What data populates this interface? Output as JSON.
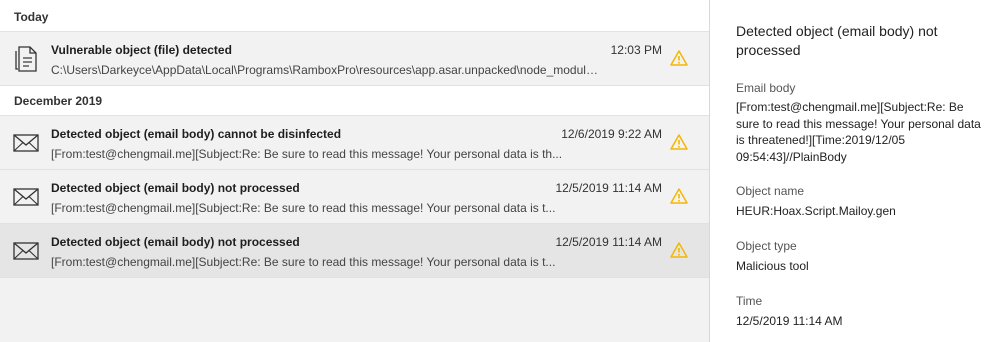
{
  "groups": [
    {
      "label": "Today"
    },
    {
      "label": "December 2019"
    }
  ],
  "items": [
    {
      "title": "Vulnerable object (file) detected",
      "preview": "C:\\Users\\Darkeyce\\AppData\\Local\\Programs\\RamboxPro\\resources\\app.asar.unpacked\\node_modules\\...",
      "time": "12:03 PM",
      "icon": "file-icon"
    },
    {
      "title": "Detected object (email body) cannot be disinfected",
      "preview": "[From:test@chengmail.me][Subject:Re: Be sure to read this message! Your personal data is th...",
      "time": "12/6/2019 9:22 AM",
      "icon": "envelope-icon"
    },
    {
      "title": "Detected object (email body) not processed",
      "preview": "[From:test@chengmail.me][Subject:Re: Be sure to read this message! Your personal data is t...",
      "time": "12/5/2019 11:14 AM",
      "icon": "envelope-icon"
    },
    {
      "title": "Detected object (email body) not processed",
      "preview": "[From:test@chengmail.me][Subject:Re: Be sure to read this message! Your personal data is t...",
      "time": "12/5/2019 11:14 AM",
      "icon": "envelope-icon",
      "selected": true
    }
  ],
  "detail": {
    "title": "Detected object (email body) not processed",
    "fields": [
      {
        "label": "Email body",
        "value": "[From:test@chengmail.me][Subject:Re: Be sure to read this message! Your personal data is threatened!][Time:2019/12/05 09:54:43]//PlainBody"
      },
      {
        "label": "Object name",
        "value": "HEUR:Hoax.Script.Mailoy.gen"
      },
      {
        "label": "Object type",
        "value": "Malicious tool"
      },
      {
        "label": "Time",
        "value": "12/5/2019 11:14 AM"
      }
    ]
  },
  "colors": {
    "warning": "#f2b705",
    "icon_stroke": "#333333"
  }
}
